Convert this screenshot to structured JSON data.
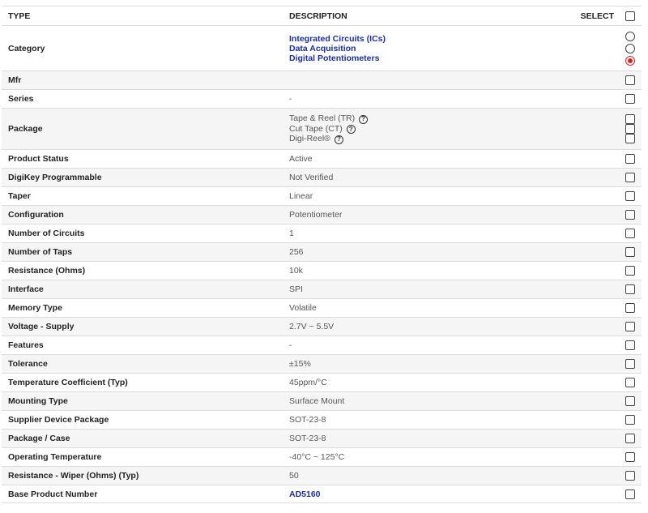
{
  "header": {
    "type": "TYPE",
    "description": "DESCRIPTION",
    "select": "SELECT"
  },
  "category": {
    "label": "Category",
    "values": [
      "Integrated Circuits (ICs)",
      "Data Acquisition",
      "Digital Potentiometers"
    ],
    "selected_index": 2
  },
  "mfr": {
    "label": "Mfr",
    "value": ""
  },
  "series": {
    "label": "Series",
    "value": "-"
  },
  "package": {
    "label": "Package",
    "values": [
      "Tape & Reel (TR)",
      "Cut Tape (CT)",
      "Digi-Reel®"
    ],
    "help_icon": "question-circle-icon"
  },
  "rows": [
    {
      "label": "Product Status",
      "value": "Active"
    },
    {
      "label": "DigiKey Programmable",
      "value": "Not Verified"
    },
    {
      "label": "Taper",
      "value": "Linear"
    },
    {
      "label": "Configuration",
      "value": "Potentiometer"
    },
    {
      "label": "Number of Circuits",
      "value": "1"
    },
    {
      "label": "Number of Taps",
      "value": "256"
    },
    {
      "label": "Resistance (Ohms)",
      "value": "10k"
    },
    {
      "label": "Interface",
      "value": "SPI"
    },
    {
      "label": "Memory Type",
      "value": "Volatile"
    },
    {
      "label": "Voltage - Supply",
      "value": "2.7V ~ 5.5V"
    },
    {
      "label": "Features",
      "value": "-"
    },
    {
      "label": "Tolerance",
      "value": "±15%"
    },
    {
      "label": "Temperature Coefficient (Typ)",
      "value": "45ppm/°C"
    },
    {
      "label": "Mounting Type",
      "value": "Surface Mount"
    },
    {
      "label": "Supplier Device Package",
      "value": "SOT-23-8"
    },
    {
      "label": "Package / Case",
      "value": "SOT-23-8"
    },
    {
      "label": "Operating Temperature",
      "value": "-40°C ~ 125°C"
    },
    {
      "label": "Resistance - Wiper (Ohms) (Typ)",
      "value": "50"
    }
  ],
  "base_product": {
    "label": "Base Product Number",
    "value": "AD5160"
  },
  "colors": {
    "link": "#1a2fa5",
    "radio_selected": "#dd2222",
    "alt_row": "#f5f5f5",
    "border": "#dcdcdc"
  }
}
